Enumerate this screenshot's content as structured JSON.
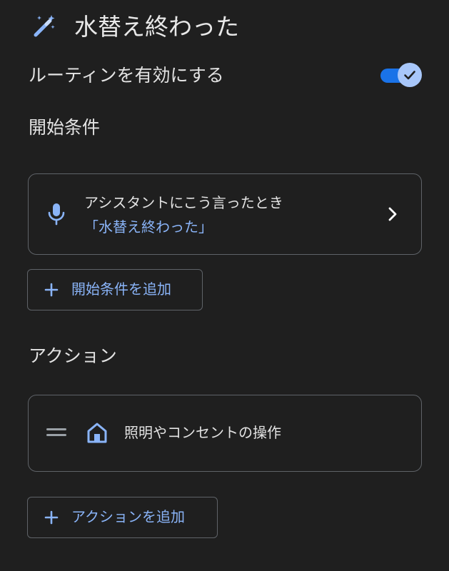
{
  "header": {
    "title": "水替え終わった",
    "icon": "magic-wand-icon"
  },
  "enable": {
    "label": "ルーティンを有効にする",
    "enabled": true
  },
  "starters": {
    "heading": "開始条件",
    "card": {
      "title": "アシスタントにこう言ったとき",
      "subtitle": "「水替え終わった」",
      "icon": "microphone-icon"
    },
    "add_label": "開始条件を追加"
  },
  "actions": {
    "heading": "アクション",
    "items": [
      {
        "label": "照明やコンセントの操作",
        "icon": "home-icon"
      }
    ],
    "add_label": "アクションを追加"
  },
  "colors": {
    "background": "#1f1f1f",
    "accent": "#8ab4f8",
    "toggle_track": "#1a73e8",
    "toggle_thumb": "#a8c7fa",
    "border": "#5f6368"
  }
}
